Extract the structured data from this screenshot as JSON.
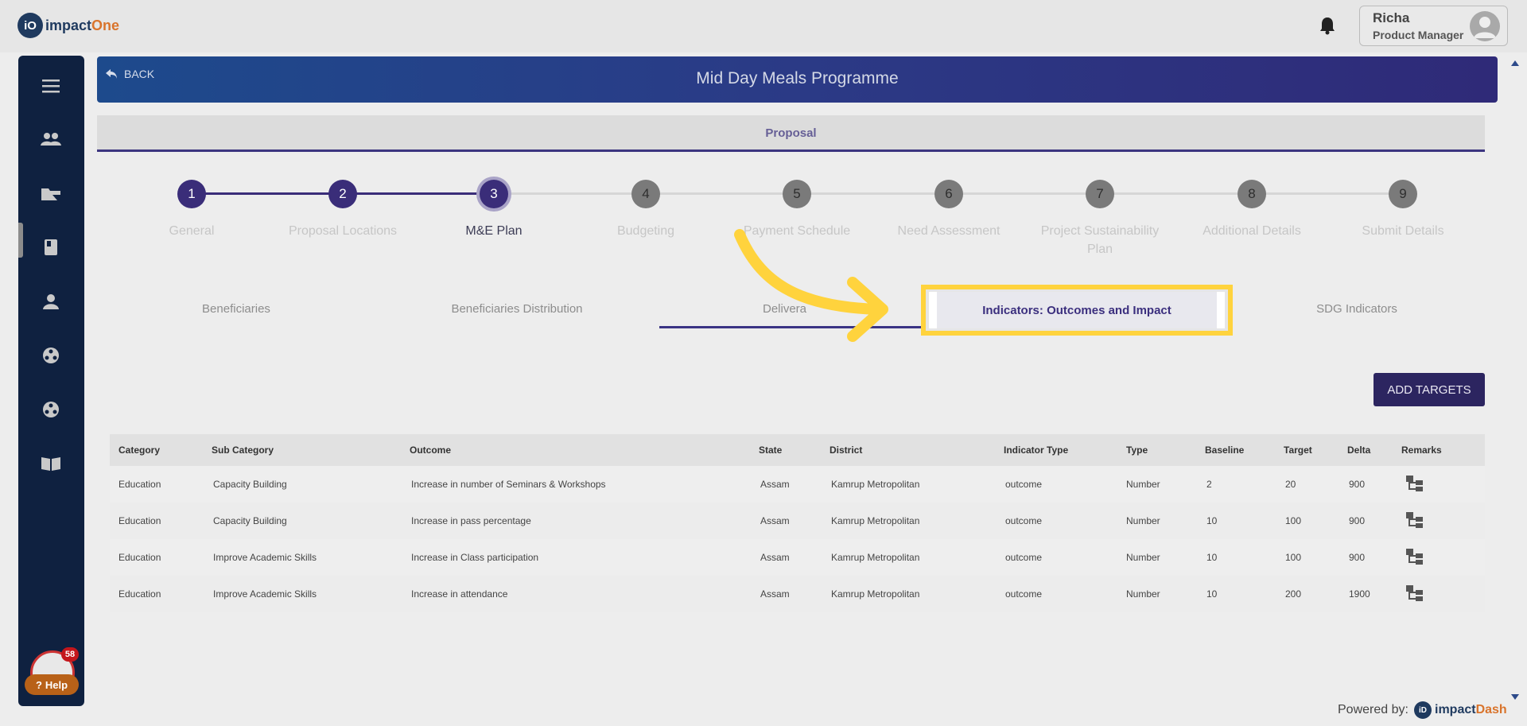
{
  "app": {
    "logo_prefix": "iO",
    "logo_name": "impact",
    "logo_accent": "One"
  },
  "user": {
    "name": "Richa",
    "role": "Product Manager"
  },
  "sidebar": {
    "icons": [
      "menu-icon",
      "users-icon",
      "folder-icon",
      "book-icon",
      "person-icon",
      "network-icon",
      "network-icon-2",
      "open-book-icon"
    ],
    "help_badge_count": "58",
    "help_label": "Help"
  },
  "banner": {
    "back_label": "BACK",
    "title": "Mid Day Meals Programme"
  },
  "proposal_tab": {
    "label": "Proposal"
  },
  "stepper": {
    "steps": [
      {
        "number": "1",
        "label": "General",
        "state": "done"
      },
      {
        "number": "2",
        "label": "Proposal Locations",
        "state": "done"
      },
      {
        "number": "3",
        "label": "M&E Plan",
        "state": "current"
      },
      {
        "number": "4",
        "label": "Budgeting",
        "state": "todo"
      },
      {
        "number": "5",
        "label": "Payment Schedule",
        "state": "todo"
      },
      {
        "number": "6",
        "label": "Need Assessment",
        "state": "todo"
      },
      {
        "number": "7",
        "label": "Project Sustainability Plan",
        "state": "todo"
      },
      {
        "number": "8",
        "label": "Additional Details",
        "state": "todo"
      },
      {
        "number": "9",
        "label": "Submit Details",
        "state": "todo"
      }
    ]
  },
  "subtabs": {
    "beneficiaries": "Beneficiaries",
    "distribution": "Beneficiaries Distribution",
    "deliverables": "Delivera",
    "indicators": "Indicators: Outcomes and Impact",
    "sdg": "SDG Indicators"
  },
  "toolbar": {
    "add_targets_label": "ADD TARGETS"
  },
  "table": {
    "columns": [
      "Category",
      "Sub Category",
      "Outcome",
      "State",
      "District",
      "Indicator Type",
      "Type",
      "Baseline",
      "Target",
      "Delta",
      "Remarks"
    ],
    "rows": [
      [
        "Education",
        "Capacity Building",
        "Increase in number of Seminars & Workshops",
        "Assam",
        "Kamrup Metropolitan",
        "outcome",
        "Number",
        "2",
        "20",
        "900"
      ],
      [
        "Education",
        "Capacity Building",
        "Increase in pass percentage",
        "Assam",
        "Kamrup Metropolitan",
        "outcome",
        "Number",
        "10",
        "100",
        "900"
      ],
      [
        "Education",
        "Improve Academic Skills",
        "Increase in Class participation",
        "Assam",
        "Kamrup Metropolitan",
        "outcome",
        "Number",
        "10",
        "100",
        "900"
      ],
      [
        "Education",
        "Improve Academic Skills",
        "Increase in attendance",
        "Assam",
        "Kamrup Metropolitan",
        "outcome",
        "Number",
        "10",
        "200",
        "1900"
      ]
    ]
  },
  "footer": {
    "powered_by": "Powered by:",
    "logo_prefix": "iD",
    "logo_name": "impact",
    "logo_accent": "Dash"
  },
  "colors": {
    "primary": "#3a2d79",
    "highlight": "#ffd33d",
    "sidebar": "#0f2140",
    "accent": "#d9742c"
  }
}
